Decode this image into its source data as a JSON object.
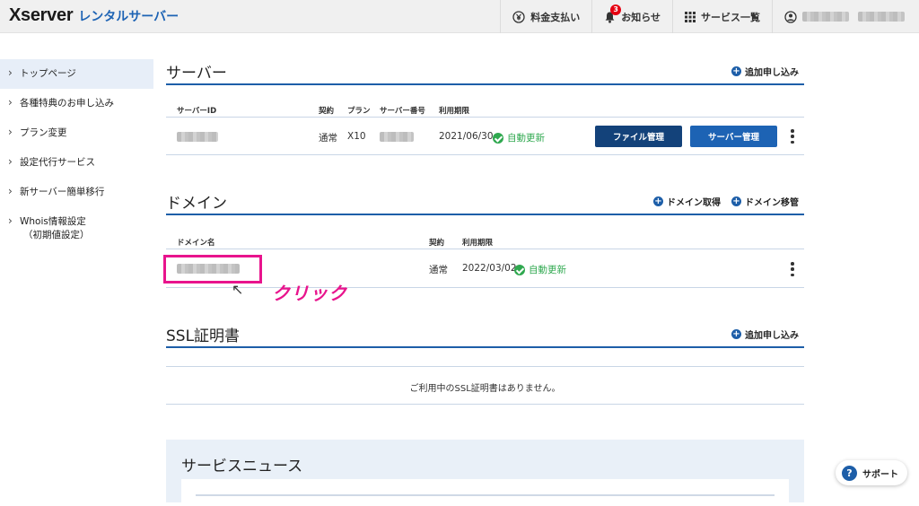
{
  "header": {
    "logo_main": "Xserver",
    "logo_sub": "レンタルサーバー",
    "nav": {
      "billing": "料金支払い",
      "notifications": "お知らせ",
      "notifications_count": "3",
      "services": "サービス一覧"
    }
  },
  "sidebar": {
    "items": [
      {
        "label": "トップページ"
      },
      {
        "label": "各種特典のお申し込み"
      },
      {
        "label": "プラン変更"
      },
      {
        "label": "設定代行サービス"
      },
      {
        "label": "新サーバー簡単移行"
      },
      {
        "label": "Whois情報設定",
        "sub": "（初期値設定）"
      }
    ]
  },
  "server": {
    "title": "サーバー",
    "add_label": "追加申し込み",
    "columns": {
      "id": "サーバーID",
      "contract": "契約",
      "plan": "プラン",
      "number": "サーバー番号",
      "expiry": "利用期限"
    },
    "row": {
      "contract": "通常",
      "plan": "X10",
      "expiry": "2021/06/30",
      "renewal": "自動更新"
    },
    "file_button": "ファイル管理",
    "server_button": "サーバー管理"
  },
  "domain": {
    "title": "ドメイン",
    "acquire_label": "ドメイン取得",
    "transfer_label": "ドメイン移管",
    "columns": {
      "name": "ドメイン名",
      "contract": "契約",
      "expiry": "利用期限"
    },
    "row": {
      "contract": "通常",
      "expiry": "2022/03/02",
      "renewal": "自動更新"
    }
  },
  "ssl": {
    "title": "SSL証明書",
    "add_label": "追加申し込み",
    "empty_message": "ご利用中のSSL証明書はありません。"
  },
  "news": {
    "title": "サービスニュース"
  },
  "annotation": {
    "arrow": "↖",
    "click_text": "クリック"
  },
  "support": {
    "label": "サポート"
  },
  "colors": {
    "accent": "#1d5ea8",
    "highlight": "#e8148d",
    "status_green": "#2fa84f"
  }
}
